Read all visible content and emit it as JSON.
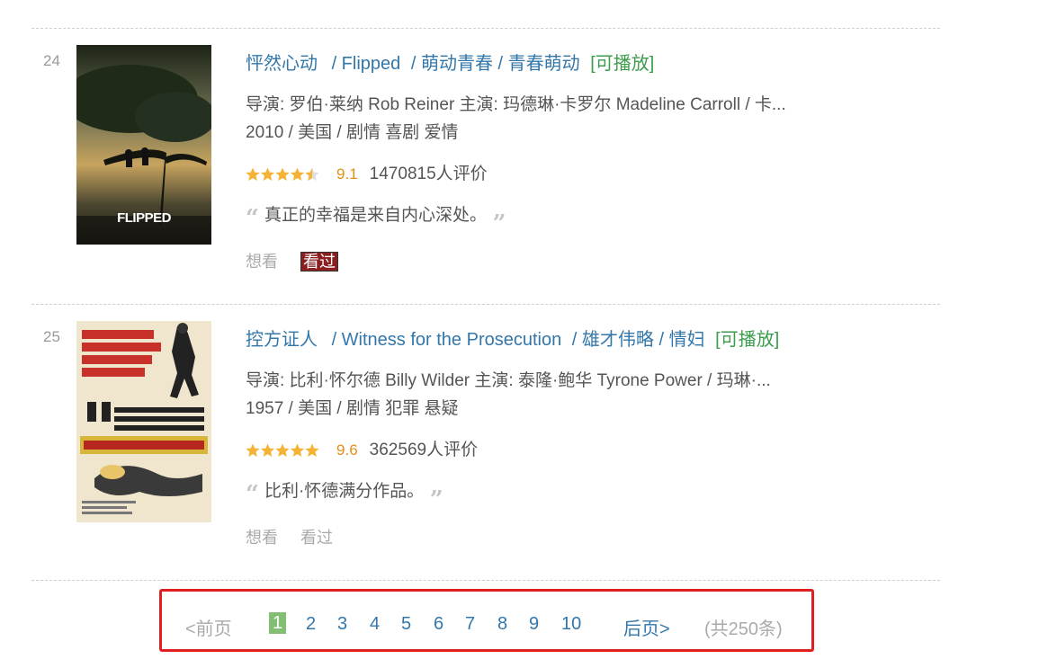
{
  "movies": [
    {
      "rank": "24",
      "poster_caption": "FLIPPED",
      "title_cn": "怦然心动",
      "title_en": "/ Flipped",
      "title_other": "/ 萌动青春 / 青春萌动",
      "playable": "[可播放]",
      "credits": "导演: 罗伯·莱纳 Rob Reiner   主演: 玛德琳·卡罗尔 Madeline Carroll / 卡...",
      "info": "2010 / 美国 / 剧情 喜剧 爱情",
      "stars": 4.5,
      "score": "9.1",
      "votes": "1470815人评价",
      "quote": "真正的幸福是来自内心深处。",
      "want": "想看",
      "seen": "看过",
      "seen_active": true
    },
    {
      "rank": "25",
      "poster_caption": "WITNESS FOR THE PROSECUTION",
      "title_cn": "控方证人",
      "title_en": "/ Witness for the Prosecution",
      "title_other": "/ 雄才伟略 / 情妇",
      "playable": "[可播放]",
      "credits": "导演: 比利·怀尔德 Billy Wilder   主演: 泰隆·鲍华 Tyrone Power / 玛琳·...",
      "info": "1957 / 美国 / 剧情 犯罪 悬疑",
      "stars": 5,
      "score": "9.6",
      "votes": "362569人评价",
      "quote": "比利·怀德满分作品。",
      "want": "想看",
      "seen": "看过",
      "seen_active": false
    }
  ],
  "paginator": {
    "prev": "<前页",
    "pages": [
      "1",
      "2",
      "3",
      "4",
      "5",
      "6",
      "7",
      "8",
      "9",
      "10"
    ],
    "current": "1",
    "next": "后页>",
    "total": "(共250条)"
  },
  "colors": {
    "link": "#3377aa",
    "playable": "#3e9d4d",
    "star": "#f5b335",
    "score": "#e09015",
    "current_page_bg": "#83bf73",
    "highlight_border": "#e02020"
  }
}
